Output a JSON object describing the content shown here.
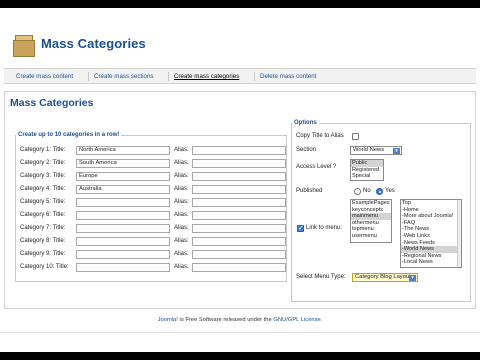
{
  "header": {
    "title": "Mass Categories"
  },
  "tabs": [
    {
      "label": "Create mass content"
    },
    {
      "label": "Create mass sections"
    },
    {
      "label": "Create mass categories"
    },
    {
      "label": "Delete mass content"
    }
  ],
  "page_title": "Mass Categories",
  "categories": {
    "legend": "Create up to 10 categories in a row!",
    "alias_label": "Alias:",
    "rows": [
      {
        "label": "Category 1: Title:",
        "title": "North America"
      },
      {
        "label": "Category 2: Title:",
        "title": "South America"
      },
      {
        "label": "Category 3: Title:",
        "title": "Europe"
      },
      {
        "label": "Category 4: Title:",
        "title": "Australia"
      },
      {
        "label": "Category 5: Title:",
        "title": ""
      },
      {
        "label": "Category 6: Title:",
        "title": ""
      },
      {
        "label": "Category 7: Title:",
        "title": ""
      },
      {
        "label": "Category 8: Title:",
        "title": ""
      },
      {
        "label": "Category 9: Title:",
        "title": ""
      },
      {
        "label": "Category 10: Title:",
        "title": ""
      }
    ]
  },
  "options": {
    "legend": "Options",
    "copy_title_label": "Copy Title to Alias",
    "section_label": "Section",
    "section_value": "World News",
    "access_label": "Access Level ?",
    "access_levels": [
      "Public",
      "Registered",
      "Special"
    ],
    "published_label": "Published",
    "no_label": "No",
    "yes_label": "Yes",
    "link_label": "Link to menu:",
    "menus": [
      "ExamplePages",
      "keyconcepts",
      "mainmenu",
      "othermenu",
      "topmenu",
      "usermenu"
    ],
    "menu_items": [
      "Top",
      "-Home",
      "-More about Joomla!",
      "-FAQ",
      "-The News",
      "-Web Links",
      "-News Feeds",
      "-World News",
      "-Regional News",
      "-Local News"
    ],
    "menu_type_label": "Select Menu Type:",
    "menu_type_value": "Category Blog Layout"
  },
  "footer": {
    "link": "Joomla!",
    "mid": "is Free Software released under the",
    "license": "GNU/GPL License."
  },
  "colors": {
    "accent": "#1b4f8f",
    "selection": "#3b7fd4"
  }
}
